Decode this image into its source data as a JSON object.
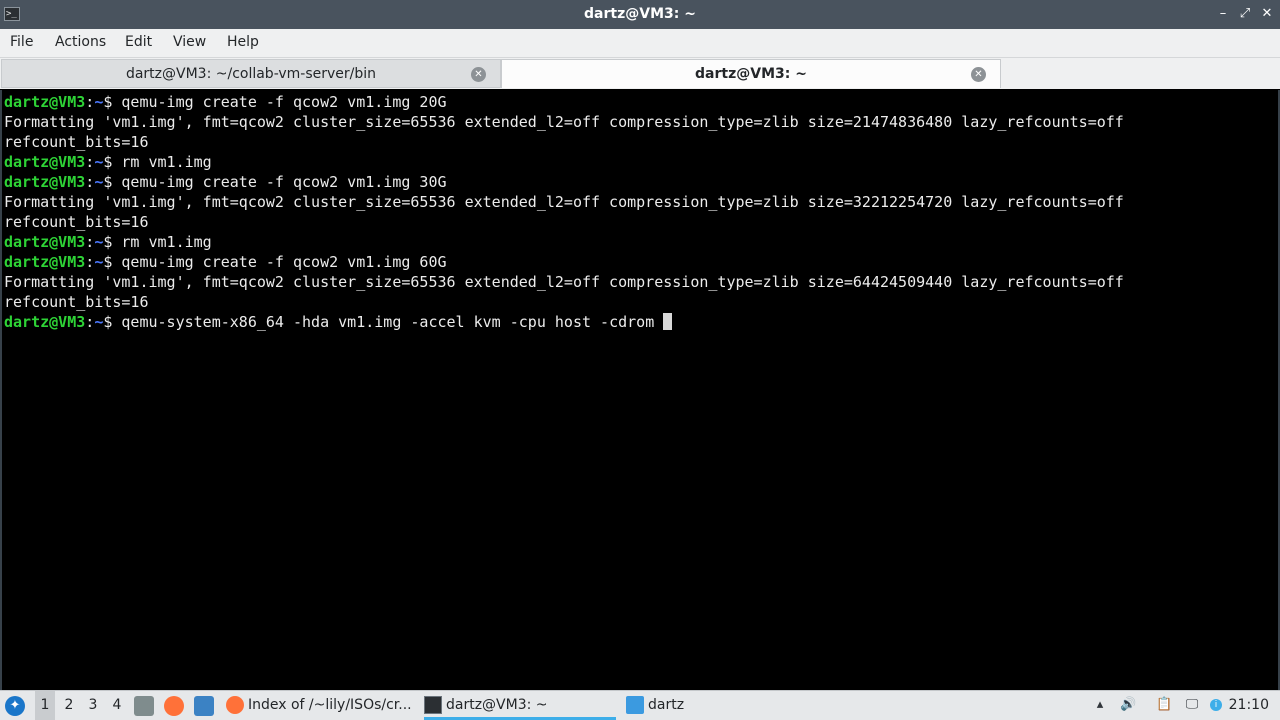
{
  "window": {
    "title": "dartz@VM3: ~",
    "controls": {
      "minimize": "–",
      "restore": "⤢",
      "close": "✕"
    }
  },
  "menu": [
    "File",
    "Actions",
    "Edit",
    "View",
    "Help"
  ],
  "tabs": [
    {
      "label": "dartz@VM3: ~/collab-vm-server/bin",
      "active": false
    },
    {
      "label": "dartz@VM3: ~",
      "active": true
    }
  ],
  "terminal": {
    "prompt_user": "dartz@VM3",
    "prompt_colon": ":",
    "prompt_path": "~",
    "prompt_symbol": "$",
    "lines": [
      {
        "type": "cmd",
        "text": " qemu-img create -f qcow2 vm1.img 20G"
      },
      {
        "type": "out",
        "text": "Formatting 'vm1.img', fmt=qcow2 cluster_size=65536 extended_l2=off compression_type=zlib size=21474836480 lazy_refcounts=off"
      },
      {
        "type": "out",
        "text": "refcount_bits=16"
      },
      {
        "type": "cmd",
        "text": " rm vm1.img"
      },
      {
        "type": "cmd",
        "text": " qemu-img create -f qcow2 vm1.img 30G"
      },
      {
        "type": "out",
        "text": "Formatting 'vm1.img', fmt=qcow2 cluster_size=65536 extended_l2=off compression_type=zlib size=32212254720 lazy_refcounts=off"
      },
      {
        "type": "out",
        "text": "refcount_bits=16"
      },
      {
        "type": "cmd",
        "text": " rm vm1.img"
      },
      {
        "type": "cmd",
        "text": " qemu-img create -f qcow2 vm1.img 60G"
      },
      {
        "type": "out",
        "text": "Formatting 'vm1.img', fmt=qcow2 cluster_size=65536 extended_l2=off compression_type=zlib size=64424509440 lazy_refcounts=off"
      },
      {
        "type": "out",
        "text": "refcount_bits=16"
      },
      {
        "type": "cmd",
        "text": " qemu-system-x86_64 -hda vm1.img -accel kvm -cpu host -cdrom "
      }
    ]
  },
  "taskbar": {
    "desktops": [
      "1",
      "2",
      "3",
      "4"
    ],
    "tasks": [
      {
        "label": "Index of /~lily/ISOs/cr...",
        "icon": "firefox-icon"
      },
      {
        "label": "dartz@VM3: ~",
        "icon": "terminal-icon"
      },
      {
        "label": "dartz",
        "icon": "folder-icon"
      }
    ],
    "clock": "21:10"
  },
  "colors": {
    "accent": "#3daee9",
    "prompt_user": "#2ed336",
    "prompt_path": "#4d79ff",
    "titlebar": "#49535e"
  }
}
